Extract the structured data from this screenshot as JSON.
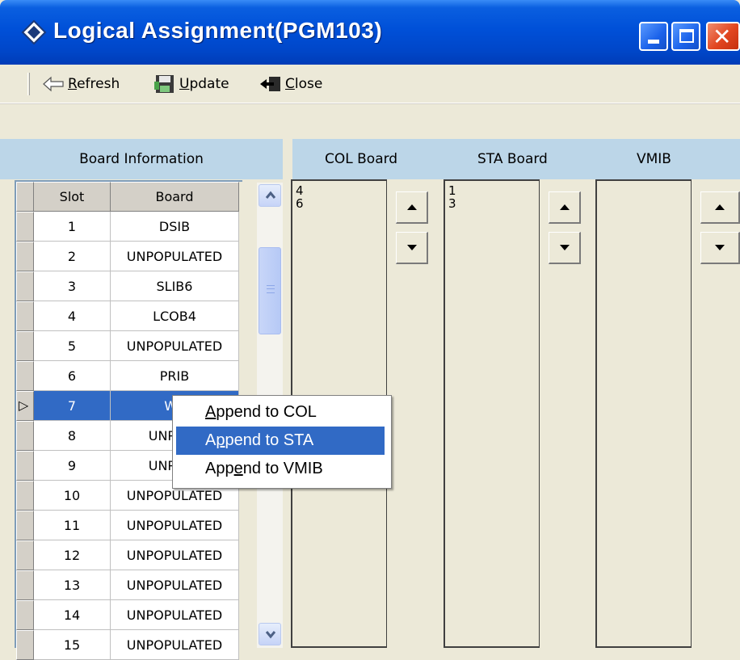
{
  "window": {
    "title": "Logical Assignment(PGM103)"
  },
  "toolbar": {
    "refresh": {
      "mnemonic": "R",
      "rest": "efresh"
    },
    "update": {
      "mnemonic": "U",
      "rest": "pdate"
    },
    "close": {
      "mnemonic": "C",
      "rest": "lose"
    }
  },
  "board_info": {
    "title": "Board Information",
    "columns": [
      "Slot",
      "Board"
    ],
    "rows": [
      {
        "slot": "1",
        "board": "DSIB"
      },
      {
        "slot": "2",
        "board": "UNPOPULATED"
      },
      {
        "slot": "3",
        "board": "SLIB6"
      },
      {
        "slot": "4",
        "board": "LCOB4"
      },
      {
        "slot": "5",
        "board": "UNPOPULATED"
      },
      {
        "slot": "6",
        "board": "PRIB"
      },
      {
        "slot": "7",
        "board": "WT"
      },
      {
        "slot": "8",
        "board": "UNPOPL"
      },
      {
        "slot": "9",
        "board": "UNPOPL"
      },
      {
        "slot": "10",
        "board": "UNPOPULATED"
      },
      {
        "slot": "11",
        "board": "UNPOPULATED"
      },
      {
        "slot": "12",
        "board": "UNPOPULATED"
      },
      {
        "slot": "13",
        "board": "UNPOPULATED"
      },
      {
        "slot": "14",
        "board": "UNPOPULATED"
      },
      {
        "slot": "15",
        "board": "UNPOPULATED"
      }
    ],
    "current_row_slot": "7"
  },
  "assign": {
    "col_title": "COL Board",
    "sta_title": "STA Board",
    "vmib_title": "VMIB",
    "col_items": [
      "4",
      "6"
    ],
    "sta_items": [
      "1",
      "3"
    ],
    "vmib_items": []
  },
  "context_menu": {
    "items": [
      {
        "pre": "",
        "mnemonic": "A",
        "post": "ppend to COL"
      },
      {
        "pre": "A",
        "mnemonic": "p",
        "post": "pend to STA"
      },
      {
        "pre": "App",
        "mnemonic": "e",
        "post": "nd to VMIB"
      }
    ],
    "highlighted_index": 1
  },
  "colors": {
    "title_bar": "#0050d8",
    "selection": "#316ac5",
    "header_band": "#bcd6e8"
  }
}
